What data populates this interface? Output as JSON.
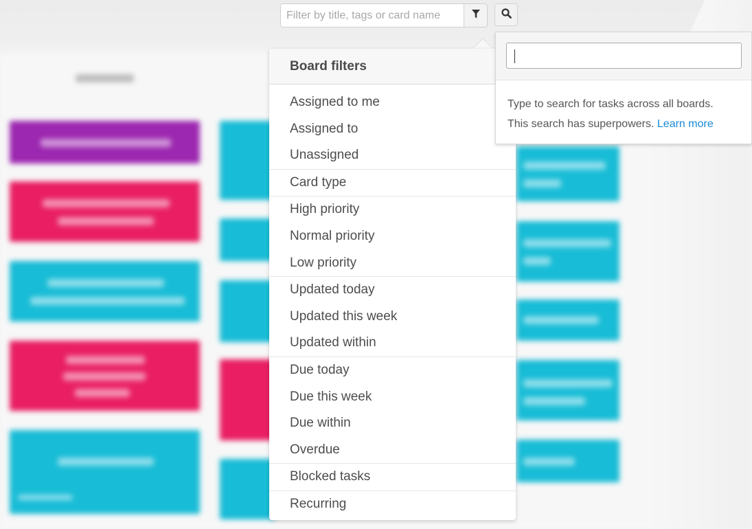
{
  "toolbar": {
    "filter_placeholder": "Filter by title, tags or card name",
    "filter_value": "",
    "filter_icon": "funnel-icon",
    "search_icon": "magnifier-icon"
  },
  "board_filters": {
    "title": "Board filters",
    "groups": [
      {
        "items": [
          "Assigned to me",
          "Assigned to",
          "Unassigned"
        ]
      },
      {
        "items": [
          "Card type"
        ]
      },
      {
        "items": [
          "High priority",
          "Normal priority",
          "Low priority"
        ]
      },
      {
        "items": [
          "Updated today",
          "Updated this week",
          "Updated within"
        ]
      },
      {
        "items": [
          "Due today",
          "Due this week",
          "Due within",
          "Overdue"
        ]
      },
      {
        "items": [
          "Blocked tasks"
        ]
      },
      {
        "items": [
          "Recurring"
        ]
      }
    ]
  },
  "search_panel": {
    "input_value": "",
    "help_line1": "Type to search for tasks across all boards.",
    "help_line2": "This search has superpowers.",
    "learn_more": "Learn more"
  },
  "colors": {
    "purple_card": "#9c27b0",
    "pink_card": "#e91e63",
    "cyan_card": "#18bcd6",
    "link": "#1a8ad6"
  }
}
